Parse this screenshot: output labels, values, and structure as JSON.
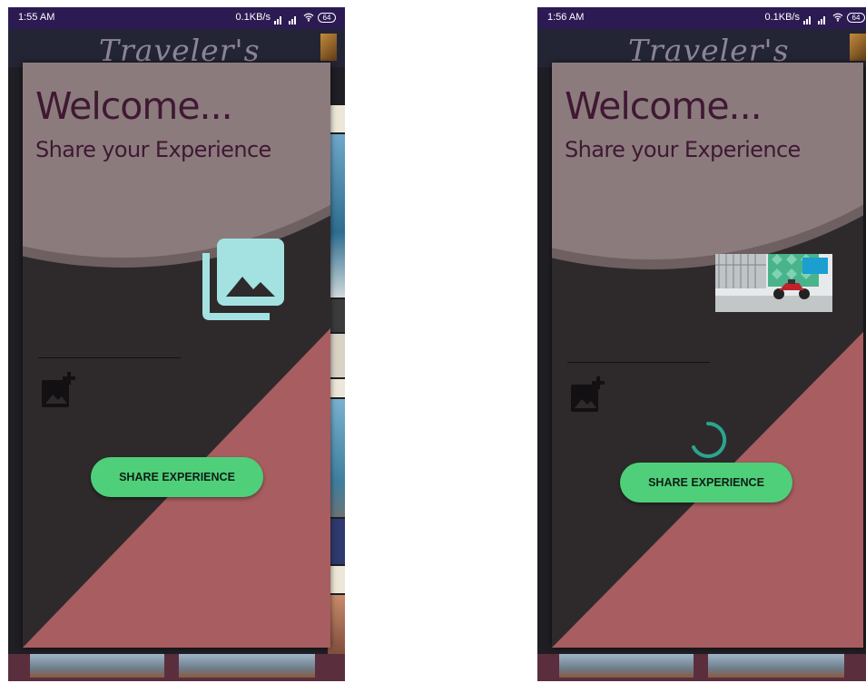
{
  "screens": [
    {
      "status": {
        "time": "1:55 AM",
        "net_speed": "0.1KB/s",
        "battery": "64"
      },
      "header_title": "Traveler's",
      "welcome": "Welcome...",
      "subtitle": "Share your Experience",
      "share_button": "SHARE EXPERIENCE",
      "state": "gallery placeholder shown"
    },
    {
      "status": {
        "time": "1:56 AM",
        "net_speed": "0.1KB/s",
        "battery": "64"
      },
      "header_title": "Traveler's",
      "welcome": "Welcome...",
      "subtitle": "Share your Experience",
      "share_button": "SHARE EXPERIENCE",
      "state": "selected photo preview with loading spinner"
    }
  ],
  "colors": {
    "status_bar": "#2c1b53",
    "dialog_bg": "#2e2a2b",
    "header_circle": "#8b7b7d",
    "diagonal_fill": "#a85d60",
    "accent_icon": "#a4e2e2",
    "button_green": "#4fcf7a",
    "title_text": "#401833"
  },
  "icons": [
    "gallery-icon",
    "add-photo-icon",
    "wifi-icon",
    "signal-icon",
    "battery-icon",
    "loading-spinner"
  ]
}
